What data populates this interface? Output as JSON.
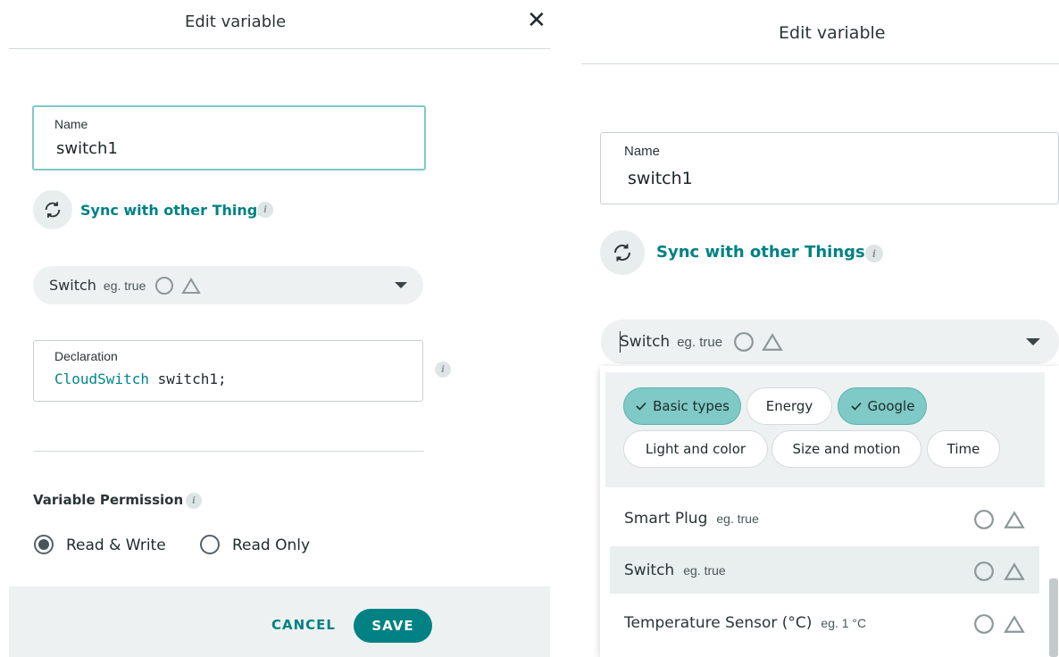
{
  "left": {
    "title": "Edit variable",
    "name_label": "Name",
    "name_value": "switch1",
    "sync_label": "Sync with other Things",
    "type_name": "Switch",
    "type_example": "eg. true",
    "declaration_label": "Declaration",
    "declaration_type": "CloudSwitch",
    "declaration_var": "switch1",
    "declaration_end": ";",
    "permission_label": "Variable Permission",
    "permission_options": [
      "Read & Write",
      "Read Only"
    ],
    "permission_selected": "Read & Write",
    "cancel_label": "CANCEL",
    "save_label": "SAVE"
  },
  "right": {
    "title": "Edit variable",
    "name_label": "Name",
    "name_value": "switch1",
    "sync_label": "Sync with other Things",
    "type_name": "Switch",
    "type_example": "eg. true",
    "chips": [
      {
        "label": "Basic types",
        "selected": true
      },
      {
        "label": "Energy",
        "selected": false
      },
      {
        "label": "Google",
        "selected": true
      },
      {
        "label": "Light and color",
        "selected": false
      },
      {
        "label": "Size and motion",
        "selected": false
      },
      {
        "label": "Time",
        "selected": false
      }
    ],
    "options": [
      {
        "name": "Smart Plug",
        "example": "eg. true"
      },
      {
        "name": "Switch",
        "example": "eg. true"
      },
      {
        "name": "Temperature Sensor (°C)",
        "example": "eg. 1 °C"
      }
    ]
  },
  "icons": {
    "close": "close-icon",
    "sync": "sync-icon",
    "info": "info-icon",
    "circle": "circle-outline-icon",
    "home": "home-icon",
    "caret": "chevron-down-icon",
    "check": "check-icon"
  },
  "colors": {
    "accent": "#008184",
    "chip_selected": "#7fc9c6",
    "focus_border": "#7fc9c6"
  }
}
